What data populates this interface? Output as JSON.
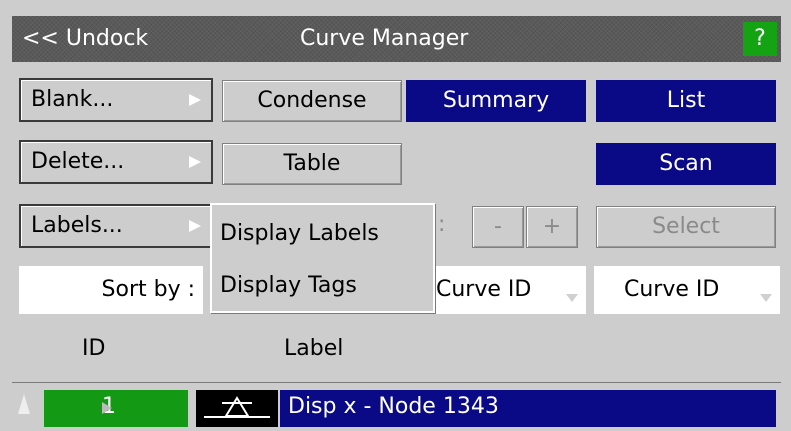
{
  "titlebar": {
    "undock_label": "<< Undock",
    "title": "Curve Manager",
    "help_label": "?"
  },
  "buttons": {
    "blank": "Blank...",
    "condense": "Condense",
    "summary": "Summary",
    "list": "List",
    "delete": "Delete...",
    "table": "Table",
    "scan": "Scan",
    "labels": "Labels...",
    "minus": "-",
    "plus": "+",
    "select": "Select"
  },
  "popup_menu": {
    "items": [
      "Display Labels",
      "Display Tags"
    ]
  },
  "sort": {
    "label": "Sort by :",
    "partial_colon": ":",
    "first_value": "Curve ID",
    "second_value": "Curve ID"
  },
  "columns": {
    "id": "ID",
    "label": "Label"
  },
  "rows": [
    {
      "id": "1",
      "label": "Disp x - Node 1343"
    }
  ],
  "colors": {
    "titlebar": "#5a5a5a",
    "help_green": "#13a313",
    "accent_blue": "#0a0a86",
    "row_green": "#139913",
    "background": "#cdcdcd"
  }
}
